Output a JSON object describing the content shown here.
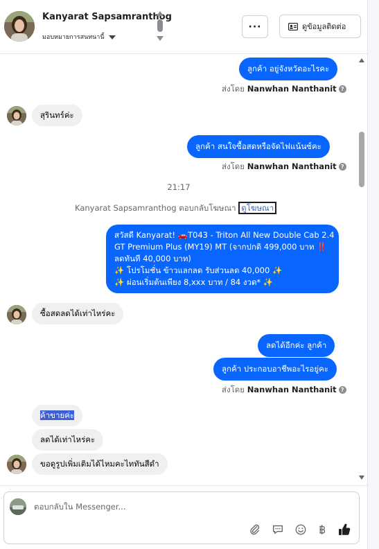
{
  "header": {
    "contact_name": "Kanyarat Sapsamranthog",
    "assign_label": "มอบหมายการสนทนานี้",
    "more_label": "···",
    "contact_info_label": "ดูข้อมูลติดต่อ"
  },
  "messages": {
    "m1": "ลูกค้า อยู่จังหวัดอะไรคะ",
    "sent_by_prefix": "ส่งโดย",
    "sender": "Nanwhan Nanthanit",
    "m2": "สุรินทร์ค่ะ",
    "m3": "ลูกค้า สนใจซื้อสดหรือจัดไฟแน้นซ์คะ",
    "time": "21:17",
    "reply_note": "Kanyarat Sapsamranthog ตอบกลับโฆษณา",
    "reply_note_link": "ดูโฆษณา",
    "promo_lines": [
      "สวัสดี Kanyarat! 🚗T043 - Triton All New Double Cab 2.4",
      "GT Premium Plus (MY19) MT (จากปกติ 499,000 บาท ‼️",
      "ลดทันที 40,000 บาท)",
      "✨ โปรโมชั่น ข้าวแลกลด รับส่วนลด 40,000 ✨",
      "✨ ผ่อนเริ่มต้นเพียง 8,xxx บาท / 84 งวด* ✨"
    ],
    "m4": "ซื้อสดลดได้เท่าไหร่คะ",
    "m5": "ลดได้อีกค่ะ  ลูกค้า",
    "m6": "ลูกค้า ประกอบอาชีพอะไรอยู่คะ",
    "m7": "ค้าขายค่ะ",
    "m8": "ลดได้เท่าไหร่คะ",
    "m9": "ขอดูรูปเพิ่มเติมได้ไหมคะไททันสีดำ"
  },
  "composer": {
    "placeholder": "ตอบกลับใน Messenger..."
  },
  "colors": {
    "outgoing_bubble": "#0866ff",
    "incoming_bubble": "#f0f0f0",
    "selection": "#3b5fd4"
  },
  "icons": [
    "chevron-up-icon",
    "chevron-down-icon",
    "more-icon",
    "contact-card-icon",
    "help-icon",
    "paperclip-icon",
    "saved-reply-icon",
    "emoji-icon",
    "baht-icon",
    "thumbs-up-icon"
  ]
}
